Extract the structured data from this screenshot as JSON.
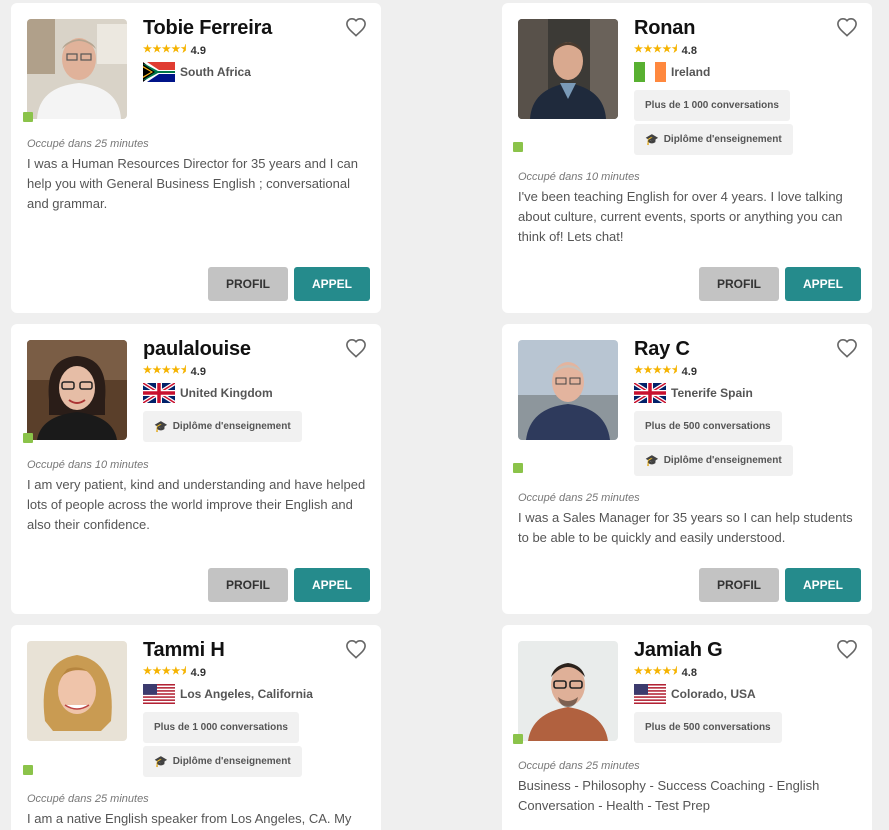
{
  "tutors": [
    {
      "name": "Tobie Ferreira",
      "rating": "4.9",
      "stars": "★★★★⯨",
      "flag": "za",
      "location": "South Africa",
      "badges": [],
      "status": "Occupé dans 25 minutes",
      "bio": "I was a Human Resources Director for 35 years and I can help you with General Business English ; conversational and grammar."
    },
    {
      "name": "Ronan",
      "rating": "4.8",
      "stars": "★★★★⯨",
      "flag": "ie",
      "location": "Ireland",
      "badges": [
        "Plus de 1 000 conversations",
        "Diplôme d'enseignement"
      ],
      "status": "Occupé dans 10 minutes",
      "bio": "I've been teaching English for over 4 years. I love talking about culture, current events, sports or anything you can think of! Lets chat!"
    },
    {
      "name": "paulalouise",
      "rating": "4.9",
      "stars": "★★★★⯨",
      "flag": "uk",
      "location": "United Kingdom",
      "badges": [
        "Diplôme d'enseignement"
      ],
      "status": "Occupé dans 10 minutes",
      "bio": "I am very patient, kind and understanding and have helped lots of people across the world improve their English and also their confidence."
    },
    {
      "name": "Ray C",
      "rating": "4.9",
      "stars": "★★★★⯨",
      "flag": "uk",
      "location": "Tenerife Spain",
      "badges": [
        "Plus de 500 conversations",
        "Diplôme d'enseignement"
      ],
      "status": "Occupé dans 25 minutes",
      "bio": "I was a Sales Manager for 35 years so I can help students to be able to be quickly and easily understood."
    },
    {
      "name": "Tammi H",
      "rating": "4.9",
      "stars": "★★★★⯨",
      "flag": "us",
      "location": "Los Angeles, California",
      "badges": [
        "Plus de 1 000 conversations",
        "Diplôme d'enseignement"
      ],
      "status": "Occupé dans 25 minutes",
      "bio": "I am a native English speaker from Los Angeles, CA. My"
    },
    {
      "name": "Jamiah G",
      "rating": "4.8",
      "stars": "★★★★⯨",
      "flag": "us",
      "location": "Colorado, USA",
      "badges": [
        "Plus de 500 conversations"
      ],
      "status": "Occupé dans 25 minutes",
      "bio": "Business - Philosophy - Success Coaching - English Conversation - Health - Test Prep"
    }
  ],
  "buttons": {
    "profile": "PROFIL",
    "call": "APPEL"
  },
  "colors": {
    "accent": "#258b8c",
    "online": "#8bc34a",
    "star": "#f5b301"
  }
}
